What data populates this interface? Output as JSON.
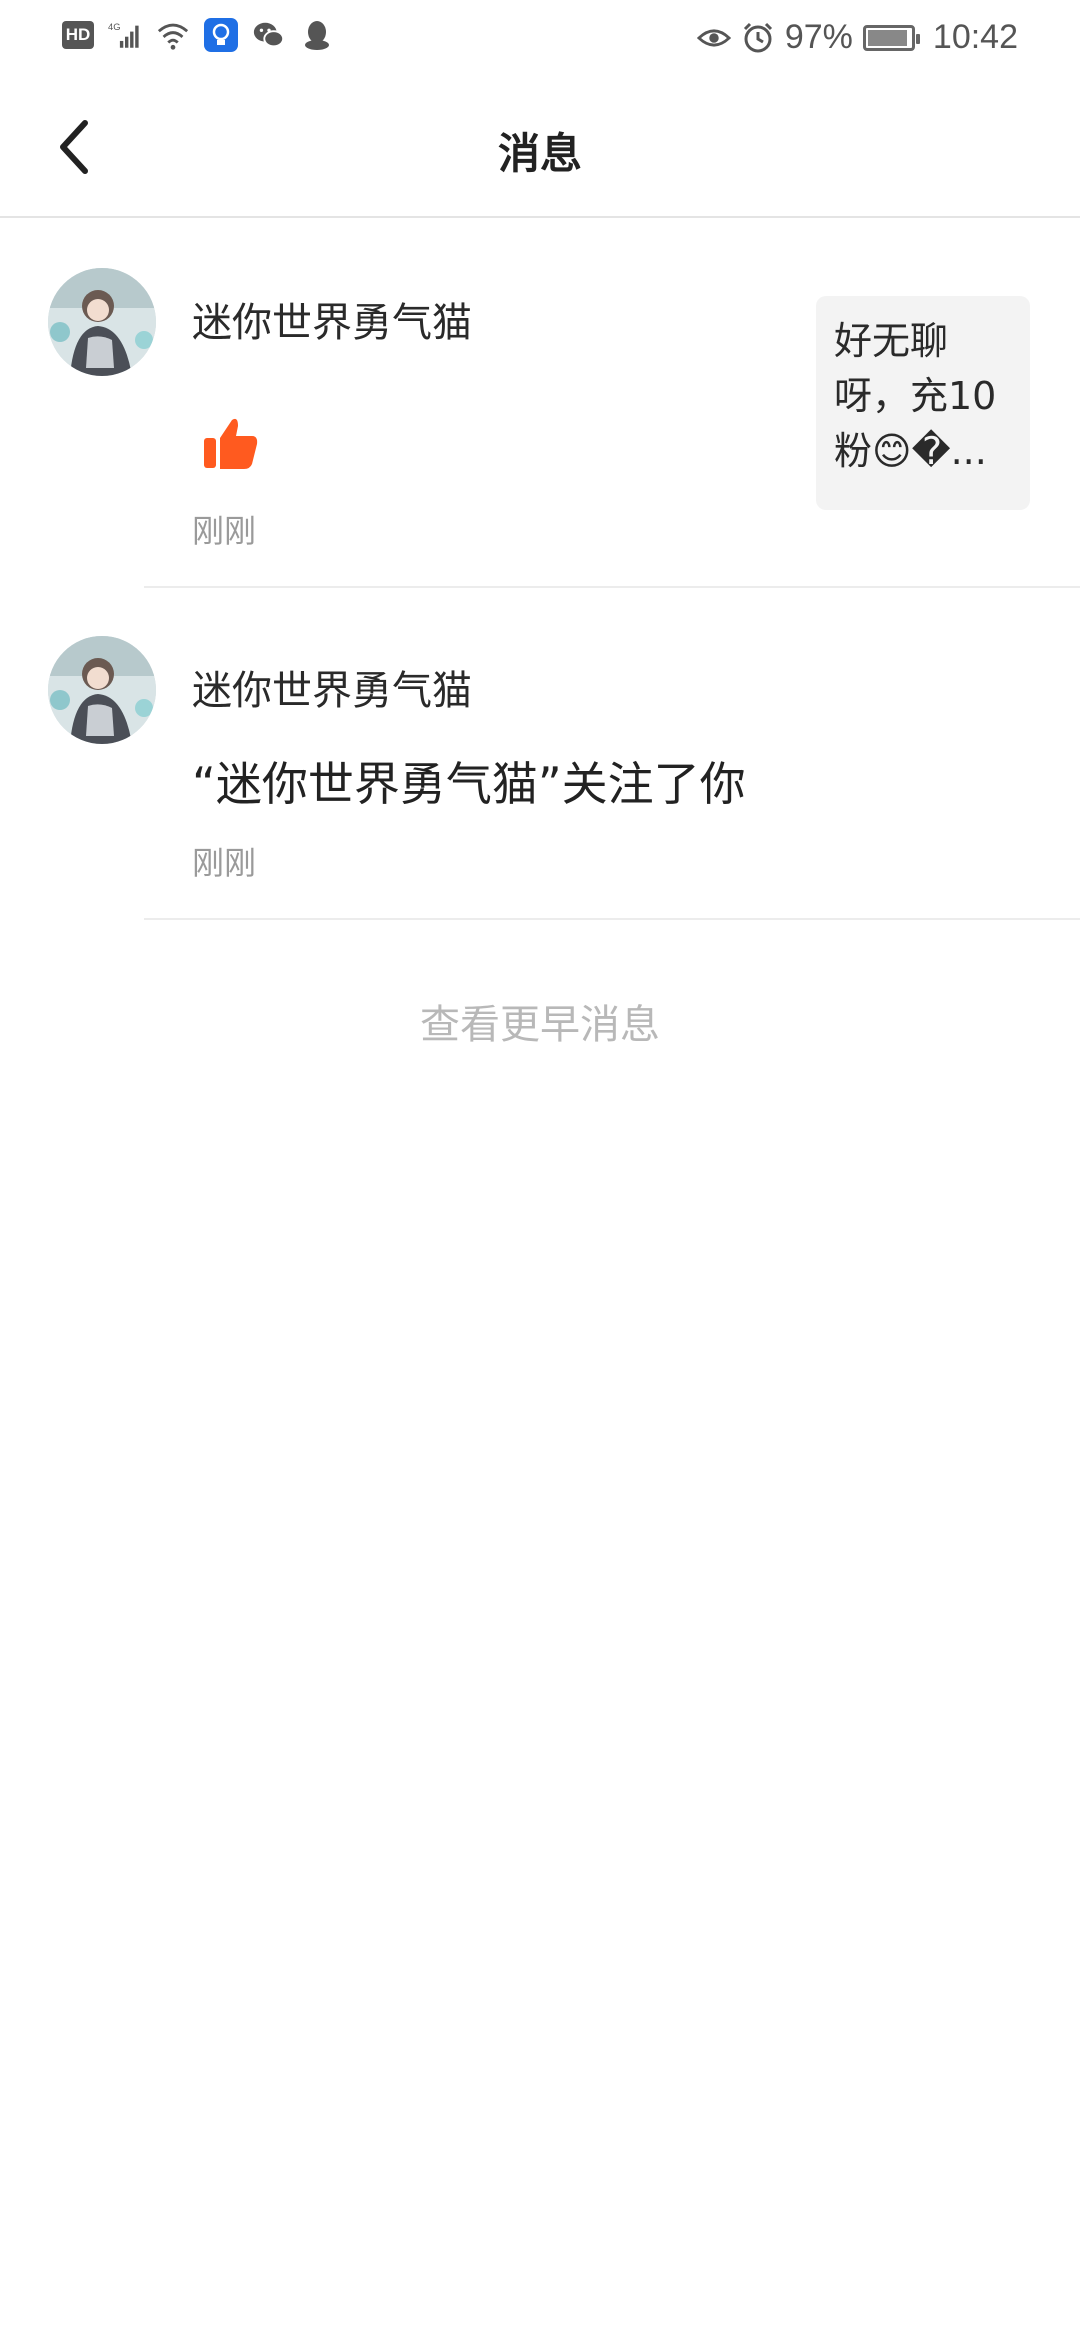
{
  "status_bar": {
    "network_badge": "HD",
    "network_type": "4G",
    "battery_percent": "97%",
    "time": "10:42",
    "icons": [
      "hd-icon",
      "signal-icon",
      "wifi-icon",
      "bulb-app-icon",
      "wechat-icon",
      "qq-icon",
      "eye-icon",
      "alarm-icon",
      "battery-icon"
    ]
  },
  "header": {
    "title": "消息"
  },
  "messages": [
    {
      "user_name": "迷你世界勇气猫",
      "type": "like",
      "icon": "thumbs-up-icon",
      "time": "刚刚",
      "quote_text": "好无聊呀，充10粉😊�...",
      "like_color": "#ff5a1f"
    },
    {
      "user_name": "迷你世界勇气猫",
      "type": "follow",
      "text": "“迷你世界勇气猫”关注了你",
      "time": "刚刚"
    }
  ],
  "footer": {
    "view_earlier": "查看更早消息"
  }
}
